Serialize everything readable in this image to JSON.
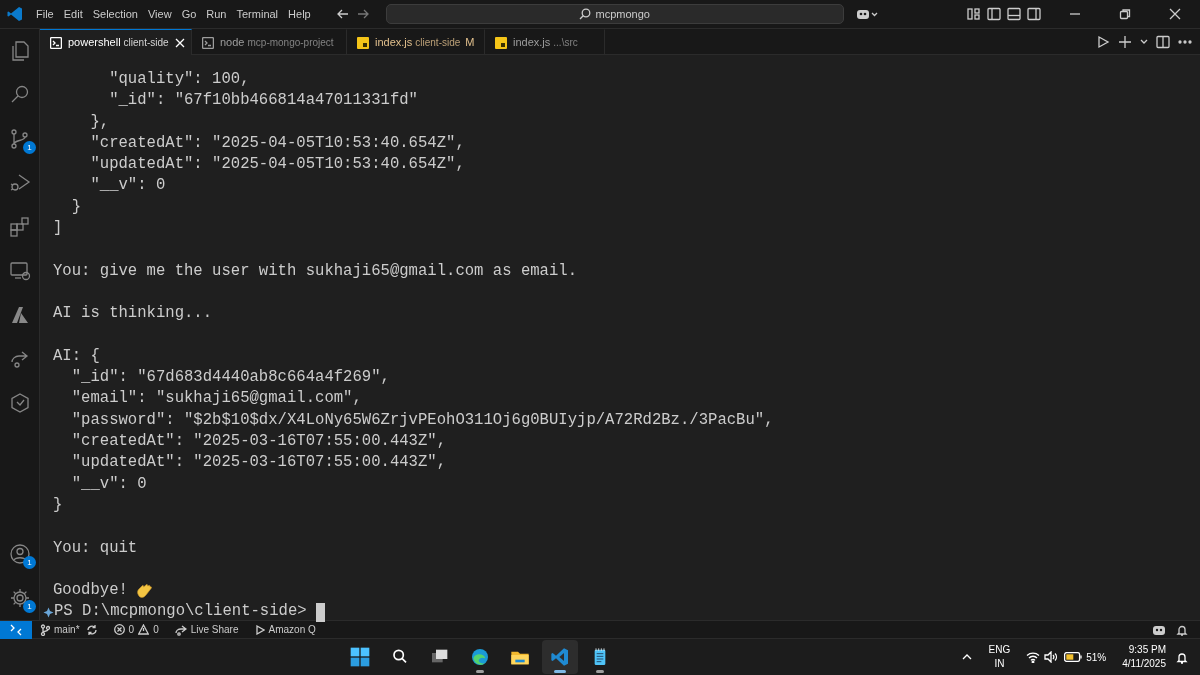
{
  "menu": [
    "File",
    "Edit",
    "Selection",
    "View",
    "Go",
    "Run",
    "Terminal",
    "Help"
  ],
  "search": {
    "value": "mcpmongo"
  },
  "activity_bar": [
    {
      "kind": "files"
    },
    {
      "kind": "search"
    },
    {
      "kind": "source-control",
      "badge": "1"
    },
    {
      "kind": "debug"
    },
    {
      "kind": "extensions"
    },
    {
      "kind": "remote"
    },
    {
      "kind": "azure"
    },
    {
      "kind": "share"
    },
    {
      "kind": "hex"
    }
  ],
  "activity_bottom": [
    {
      "kind": "account",
      "badge": "1"
    },
    {
      "kind": "gear",
      "badge": "1"
    }
  ],
  "tabs": [
    {
      "kind": "terminal",
      "label": "powershell",
      "description": "client-side",
      "selected": true,
      "modified": false
    },
    {
      "kind": "terminal",
      "label": "node",
      "description": "mcp-mongo-project",
      "selected": false,
      "modified": false
    },
    {
      "kind": "js",
      "label": "index.js",
      "description": "client-side",
      "status": "M",
      "selected": false,
      "modified": true
    },
    {
      "kind": "js",
      "label": "index.js",
      "description": "...\\src",
      "selected": false,
      "modified": false
    }
  ],
  "terminal": {
    "blocks": [
      [
        "      \"quality\": 100,",
        "      \"_id\": \"67f10bb466814a47011331fd\"",
        "    },",
        "    \"createdAt\": \"2025-04-05T10:53:40.654Z\",",
        "    \"updatedAt\": \"2025-04-05T10:53:40.654Z\",",
        "    \"__v\": 0",
        "  }",
        "]"
      ],
      [
        "You: give me the user with sukhaji65@gmail.com as email."
      ],
      [
        "AI is thinking..."
      ],
      [
        "AI: {",
        "  \"_id\": \"67d683d4440ab8c664a4f269\",",
        "  \"email\": \"sukhaji65@gmail.com\",",
        "  \"password\": \"$2b$10$dx/X4LoNy65W6ZrjvPEohO311Oj6g0BUIyjp/A72Rd2Bz./3PacBu\",",
        "  \"createdAt\": \"2025-03-16T07:55:00.443Z\",",
        "  \"updatedAt\": \"2025-03-16T07:55:00.443Z\",",
        "  \"__v\": 0",
        "}"
      ],
      [
        "You: quit"
      ]
    ],
    "farewell": "Goodbye!",
    "prompt": "PS D:\\mcpmongo\\client-side>"
  },
  "status_bar": {
    "branch": "main*",
    "errors": "0",
    "warnings": "0",
    "live_share": "Live Share",
    "extension": "Amazon Q"
  },
  "taskbar": {
    "apps": [
      {
        "kind": "start",
        "selected": false
      },
      {
        "kind": "search",
        "selected": false
      },
      {
        "kind": "taskview",
        "selected": false
      },
      {
        "kind": "edge",
        "selected": false,
        "running": true
      },
      {
        "kind": "folder",
        "selected": false,
        "running": false
      },
      {
        "kind": "vscode",
        "selected": true,
        "running": true
      },
      {
        "kind": "notepad",
        "selected": false,
        "running": true
      }
    ],
    "language": "ENG",
    "region": "IN",
    "battery": "51%",
    "time": "9:35 PM",
    "date": "4/11/2025"
  }
}
